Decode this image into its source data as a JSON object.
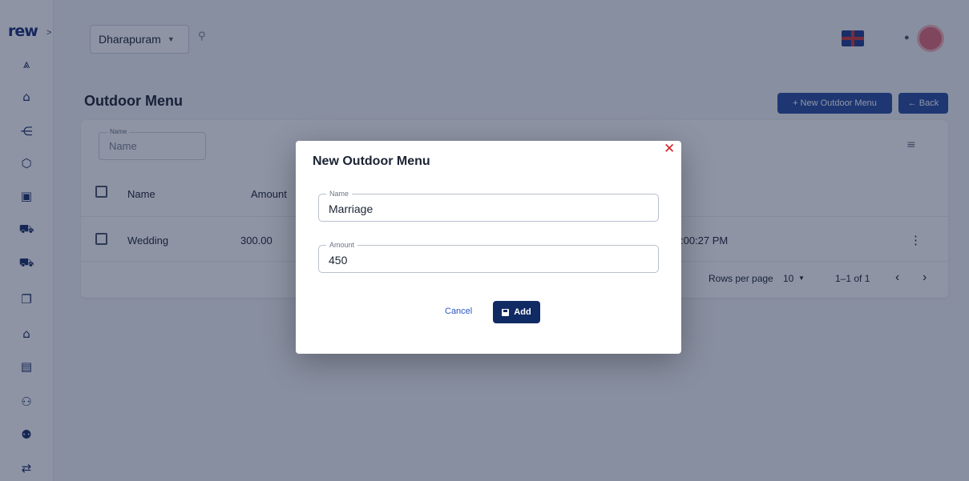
{
  "sidebar": {
    "logo": "rew",
    "expand_glyph": ">",
    "icons": [
      {
        "name": "analytics-icon",
        "glyph": "⩓"
      },
      {
        "name": "store-icon",
        "glyph": "⌂"
      },
      {
        "name": "hierarchy-icon",
        "glyph": "⋲"
      },
      {
        "name": "package-icon",
        "glyph": "⬡"
      },
      {
        "name": "bag-icon",
        "glyph": "▣"
      },
      {
        "name": "cart-icon",
        "glyph": "⛟"
      },
      {
        "name": "cart-plus-icon",
        "glyph": "⛟"
      },
      {
        "name": "copy-icon",
        "glyph": "❐"
      },
      {
        "name": "palace-icon",
        "glyph": "⌂"
      },
      {
        "name": "ledger-icon",
        "glyph": "▤"
      },
      {
        "name": "person-edit-icon",
        "glyph": "⚇"
      },
      {
        "name": "people-icon",
        "glyph": "⚉"
      },
      {
        "name": "transfer-icon",
        "glyph": "⇄"
      }
    ]
  },
  "topbar": {
    "branch": "Dharapuram",
    "search_glyph": "⚲",
    "bell_glyph": "●"
  },
  "page": {
    "title": "Outdoor Menu",
    "new_button": "+ New Outdoor Menu",
    "back_button": "← Back"
  },
  "filter": {
    "legend": "Name",
    "placeholder": "Name",
    "filter_glyph": "≡"
  },
  "table": {
    "columns": [
      "Name",
      "Amount"
    ],
    "rows": [
      {
        "name": "Wedding",
        "amount": "300.00",
        "time": ":00:27 PM",
        "menu_glyph": "⋮"
      }
    ],
    "footer": {
      "rows_per_page_label": "Rows per page",
      "rows_per_page_value": "10",
      "range": "1–1 of 1",
      "prev_glyph": "‹",
      "next_glyph": "›"
    }
  },
  "modal": {
    "title": "New Outdoor Menu",
    "close_glyph": "✕",
    "name_legend": "Name",
    "name_value": "Marriage",
    "amount_legend": "Amount",
    "amount_value": "450",
    "cancel_label": "Cancel",
    "add_label": "Add"
  },
  "colors": {
    "primary": "#2a4ea1",
    "modal_button": "#102a63",
    "close": "#d3222a",
    "backdrop": "#122040"
  }
}
